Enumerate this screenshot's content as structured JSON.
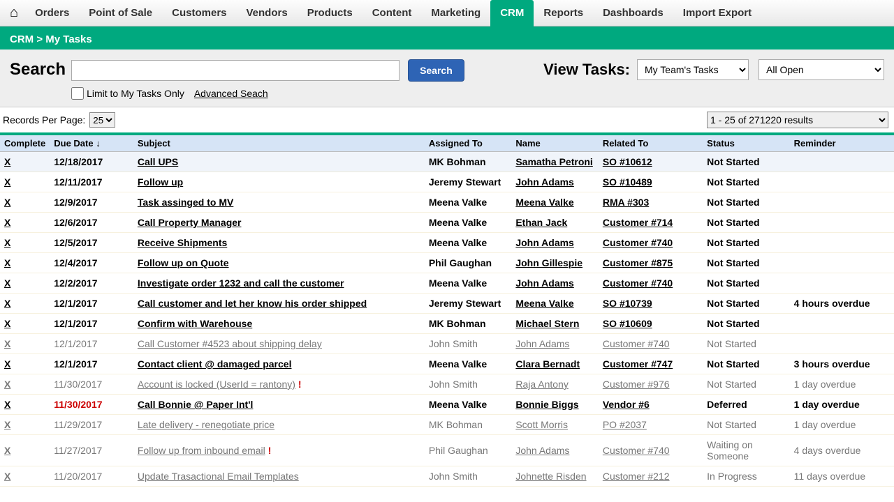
{
  "nav": {
    "items": [
      "Orders",
      "Point of Sale",
      "Customers",
      "Vendors",
      "Products",
      "Content",
      "Marketing",
      "CRM",
      "Reports",
      "Dashboards",
      "Import Export"
    ],
    "active": "CRM"
  },
  "breadcrumb": {
    "section": "CRM",
    "page": "My Tasks",
    "sep": ">"
  },
  "search": {
    "label": "Search",
    "value": "",
    "button": "Search",
    "limit_label": "Limit to My Tasks Only",
    "limit_checked": false,
    "advanced": "Advanced Seach"
  },
  "view": {
    "label": "View Tasks:",
    "team_value": "My Team's Tasks",
    "open_value": "All Open"
  },
  "records": {
    "per_page_label": "Records Per Page:",
    "per_page_value": "25",
    "results_text": "1 - 25 of 271220 results"
  },
  "table": {
    "headers": {
      "complete": "Complete",
      "due": "Due Date ↓",
      "subject": "Subject",
      "assigned": "Assigned To",
      "name": "Name",
      "related": "Related To",
      "status": "Status",
      "reminder": "Reminder"
    },
    "rows": [
      {
        "x": "X",
        "due": "12/18/2017",
        "subject": "Call UPS",
        "assigned": "MK Bohman",
        "name": "Samatha Petroni",
        "related": "SO #10612",
        "status": "Not Started",
        "reminder": "",
        "bold": true,
        "highlight": true
      },
      {
        "x": "X",
        "due": "12/11/2017",
        "subject": "Follow up",
        "assigned": "Jeremy Stewart",
        "name": "John Adams",
        "related": "SO #10489",
        "status": "Not Started",
        "reminder": "",
        "bold": true
      },
      {
        "x": "X",
        "due": "12/9/2017",
        "subject": "Task assinged to MV",
        "assigned": "Meena Valke",
        "name": "Meena Valke",
        "related": "RMA #303",
        "status": "Not Started",
        "reminder": "",
        "bold": true
      },
      {
        "x": "X",
        "due": "12/6/2017",
        "subject": "Call Property Manager",
        "assigned": "Meena Valke",
        "name": "Ethan Jack",
        "related": "Customer #714",
        "status": "Not Started",
        "reminder": "",
        "bold": true
      },
      {
        "x": "X",
        "due": "12/5/2017",
        "subject": "Receive Shipments",
        "assigned": "Meena Valke",
        "name": "John Adams",
        "related": "Customer #740",
        "status": "Not Started",
        "reminder": "",
        "bold": true
      },
      {
        "x": "X",
        "due": "12/4/2017",
        "subject": "Follow up on Quote",
        "assigned": "Phil Gaughan",
        "name": "John Gillespie",
        "related": "Customer #875",
        "status": "Not Started",
        "reminder": "",
        "bold": true
      },
      {
        "x": "X",
        "due": "12/2/2017",
        "subject": "Investigate order 1232 and call the customer",
        "assigned": "Meena Valke",
        "name": "John Adams",
        "related": "Customer #740",
        "status": "Not Started",
        "reminder": "",
        "bold": true
      },
      {
        "x": "X",
        "due": "12/1/2017",
        "subject": "Call customer and let her know his order shipped",
        "assigned": "Jeremy Stewart",
        "name": "Meena Valke",
        "related": "SO #10739",
        "status": "Not Started",
        "reminder": "4 hours overdue",
        "bold": true
      },
      {
        "x": "X",
        "due": "12/1/2017",
        "subject": "Confirm with Warehouse",
        "assigned": "MK Bohman",
        "name": "Michael Stern",
        "related": "SO #10609",
        "status": "Not Started",
        "reminder": "",
        "bold": true
      },
      {
        "x": "X",
        "due": "12/1/2017",
        "subject": "Call Customer #4523 about shipping delay",
        "assigned": "John Smith",
        "name": "John Adams",
        "related": "Customer #740",
        "status": "Not Started",
        "reminder": "",
        "dim": true
      },
      {
        "x": "X",
        "due": "12/1/2017",
        "subject": "Contact client @ damaged parcel",
        "assigned": "Meena Valke",
        "name": "Clara Bernadt",
        "related": "Customer #747",
        "status": "Not Started",
        "reminder": "3 hours overdue",
        "bold": true
      },
      {
        "x": "X",
        "due": "11/30/2017",
        "subject": "Account is locked (UserId = rantony)",
        "assigned": "John Smith",
        "name": "Raja Antony",
        "related": "Customer #976",
        "status": "Not Started",
        "reminder": "1 day overdue",
        "dim": true,
        "dueRed": true,
        "flag": true
      },
      {
        "x": "X",
        "due": "11/30/2017",
        "subject": "Call Bonnie @ Paper Int'l",
        "assigned": "Meena Valke",
        "name": "Bonnie Biggs",
        "related": "Vendor #6",
        "status": "Deferred",
        "reminder": "1 day overdue",
        "bold": true,
        "dueRed": true
      },
      {
        "x": "X",
        "due": "11/29/2017",
        "subject": "Late delivery - renegotiate price",
        "assigned": "MK Bohman",
        "name": "Scott Morris",
        "related": "PO #2037",
        "status": "Not Started",
        "reminder": "1 day overdue",
        "dim": true,
        "dueRed": true
      },
      {
        "x": "X",
        "due": "11/27/2017",
        "subject": "Follow up from inbound email",
        "assigned": "Phil Gaughan",
        "name": "John Adams",
        "related": "Customer #740",
        "status": "Waiting on Someone",
        "reminder": "4 days overdue",
        "dim": true,
        "dueRed": true,
        "flag": true
      },
      {
        "x": "X",
        "due": "11/20/2017",
        "subject": "Update Trasactional Email Templates",
        "assigned": "John Smith",
        "name": "Johnette Risden",
        "related": "Customer #212",
        "status": "In Progress",
        "reminder": "11 days overdue",
        "dim": true,
        "dueRed": true
      }
    ]
  }
}
